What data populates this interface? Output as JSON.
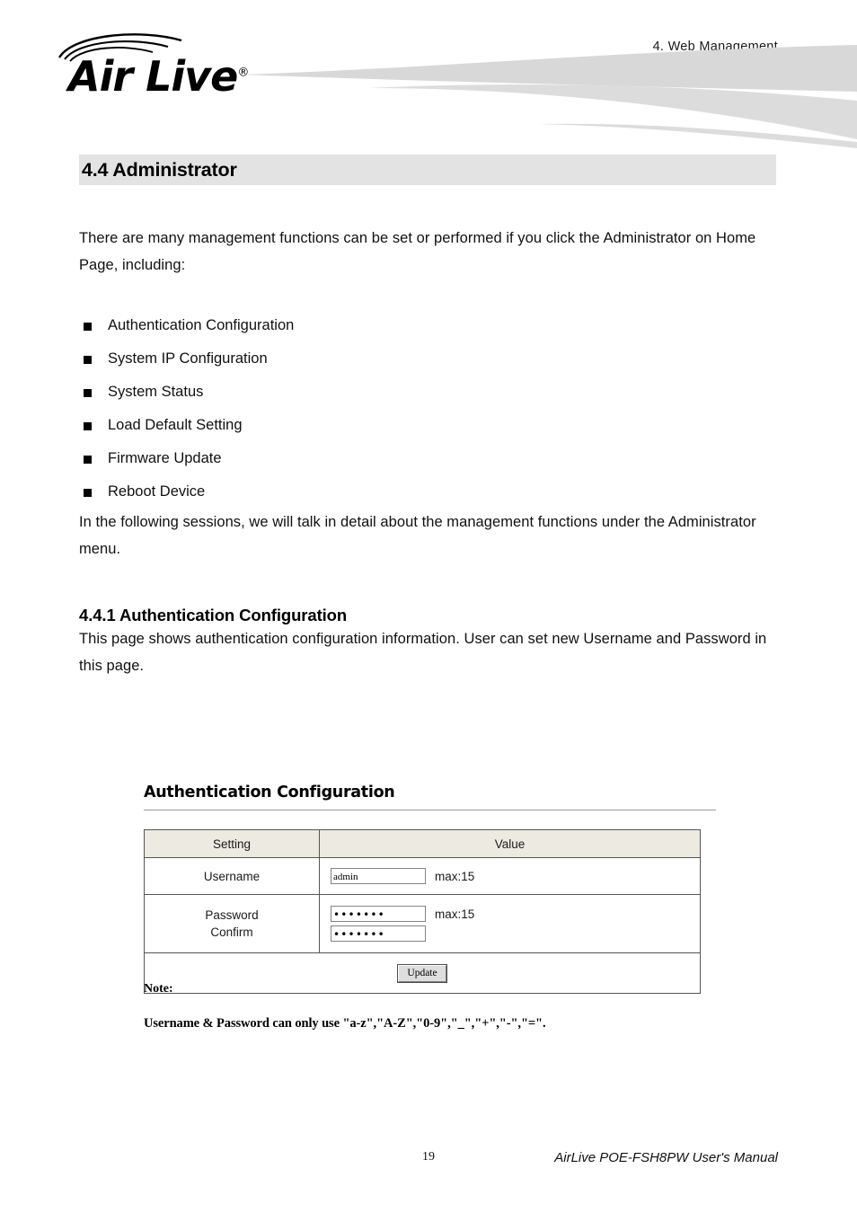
{
  "header": {
    "chapter": "4.  Web  Management",
    "logo_text": "Air Live",
    "logo_registered": "®"
  },
  "section": {
    "title": "4.4 Administrator"
  },
  "body": {
    "intro_paragraph": "There are many management functions can be set or performed if you click the Administrator on Home Page, including:",
    "bullets": [
      {
        "label": "Authentication Configuration"
      },
      {
        "label": "System IP Configuration"
      },
      {
        "label": "System Status"
      },
      {
        "label": "Load Default Setting"
      },
      {
        "label": "Firmware Update"
      },
      {
        "label": "Reboot Device"
      }
    ],
    "following_paragraph": "In the following sessions, we will talk in detail about the management functions under the Administrator menu.",
    "subsection_title": "4.4.1 Authentication Configuration",
    "subsection_paragraph": "This page shows authentication configuration information. User can set new Username and Password in this page."
  },
  "ui_screenshot": {
    "title": "Authentication Configuration",
    "table": {
      "headers": [
        "Setting",
        "Value"
      ],
      "rows": [
        {
          "setting": "Username",
          "field_value": "admin",
          "max_label": "max:15"
        },
        {
          "setting_line1": "Password",
          "setting_line2": "Confirm",
          "password_value": "•••••••",
          "confirm_value": "•••••••",
          "max_label": "max:15"
        }
      ],
      "update_button": "Update"
    }
  },
  "note": {
    "label": "Note:",
    "text": "Username & Password can only use \"a-z\",\"A-Z\",\"0-9\",\"_\",\"+\",\"-\",\"=\"."
  },
  "footer": {
    "page_number": "19",
    "manual_title": "AirLive POE-FSH8PW User's Manual"
  },
  "colors": {
    "section_bar_bg": "#e3e3e3",
    "table_header_bg": "#eceae1",
    "swoosh": "#d8d8d8",
    "table_border": "#555555"
  }
}
